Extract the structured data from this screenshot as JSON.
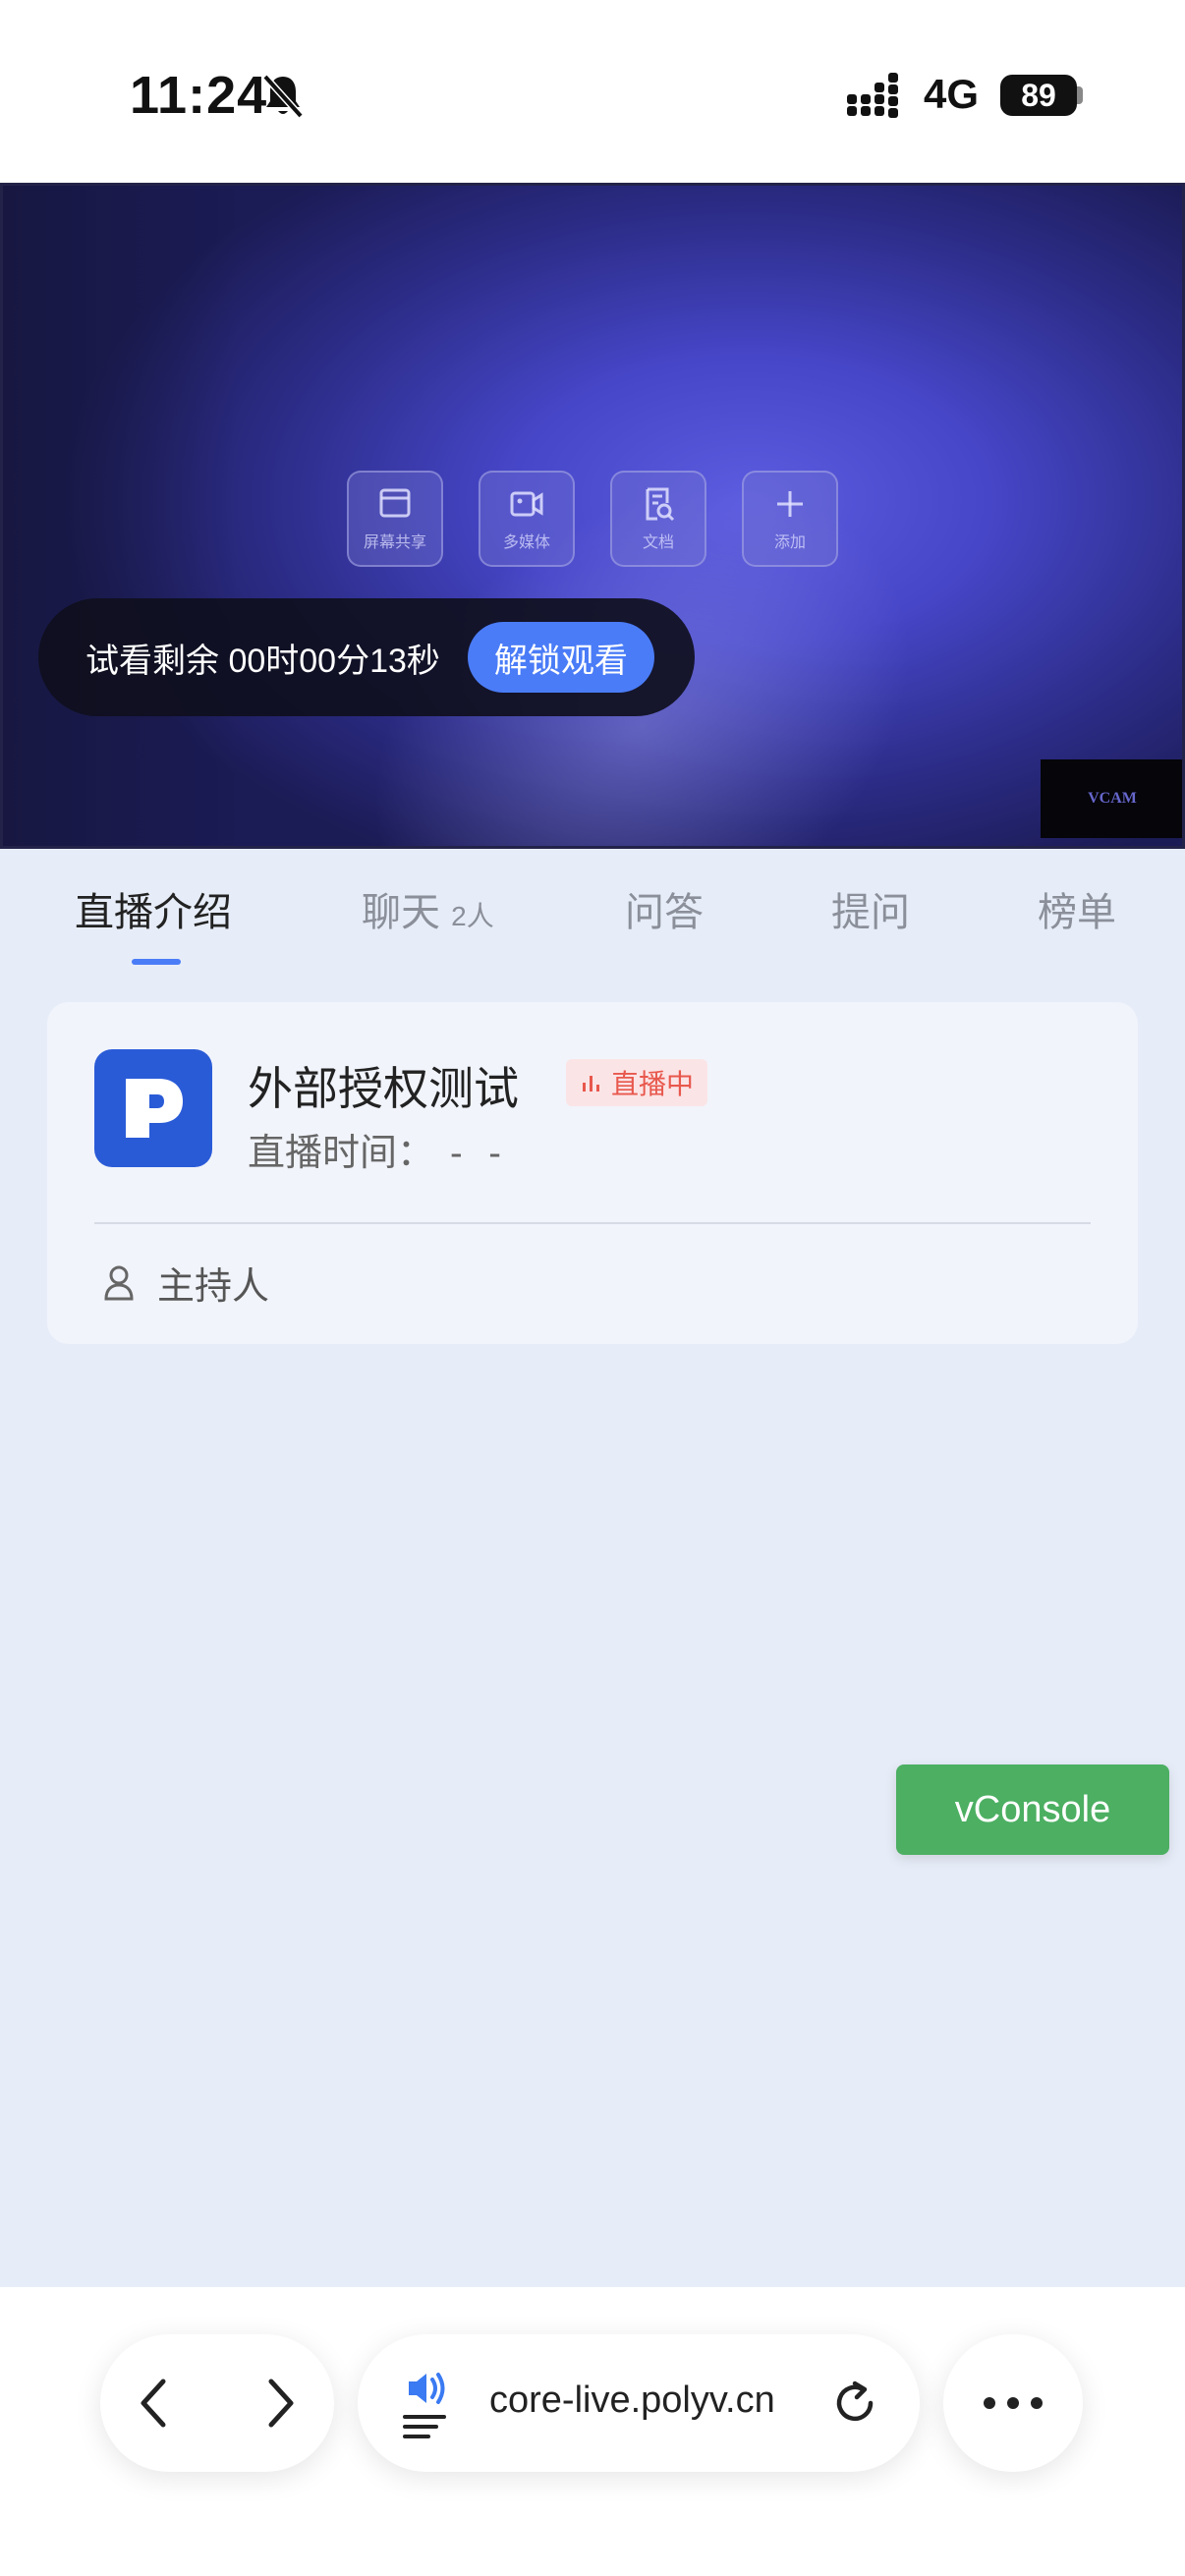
{
  "status_bar": {
    "time": "11:24",
    "network": "4G",
    "battery": "89"
  },
  "video": {
    "tools": [
      {
        "label": "屏幕共享",
        "icon": "screen-share-icon"
      },
      {
        "label": "多媒体",
        "icon": "multimedia-icon"
      },
      {
        "label": "文档",
        "icon": "document-icon"
      },
      {
        "label": "添加",
        "icon": "plus-icon"
      }
    ],
    "trial_text": "试看剩余 00时00分13秒",
    "unlock_label": "解锁观看",
    "watermark": "VCAM"
  },
  "tabs": {
    "items": [
      {
        "label": "直播介绍",
        "active": true
      },
      {
        "label": "聊天",
        "count": "2人"
      },
      {
        "label": "问答"
      },
      {
        "label": "提问"
      },
      {
        "label": "榜单"
      }
    ]
  },
  "card": {
    "title": "外部授权测试",
    "badge": "直播中",
    "time_label": "直播时间：",
    "time_value": "- -",
    "host_label": "主持人"
  },
  "vconsole_label": "vConsole",
  "browser": {
    "url": "core-live.polyv.cn"
  },
  "colors": {
    "accent": "#4a7cf7",
    "live_badge_text": "#e8584d",
    "vconsole": "#4caf62"
  }
}
